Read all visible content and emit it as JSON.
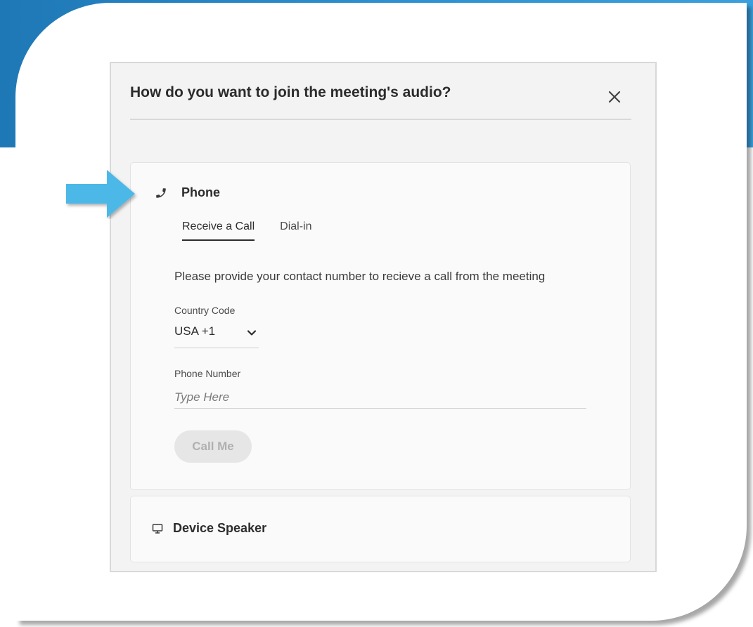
{
  "dialog": {
    "title": "How do you want to join the meeting's audio?",
    "close_icon": "close-icon"
  },
  "phone_section": {
    "icon": "phone-icon",
    "label": "Phone",
    "tabs": [
      {
        "label": "Receive a Call",
        "active": true
      },
      {
        "label": "Dial-in",
        "active": false
      }
    ],
    "instruction": "Please provide your contact number to recieve a call from the meeting",
    "country_code": {
      "label": "Country Code",
      "value": "USA +1",
      "icon": "chevron-down-icon"
    },
    "phone_number": {
      "label": "Phone Number",
      "placeholder": "Type Here",
      "value": ""
    },
    "call_button": {
      "label": "Call Me",
      "enabled": false
    }
  },
  "speaker_section": {
    "icon": "monitor-icon",
    "label": "Device Speaker"
  },
  "annotation": {
    "icon": "arrow-right-icon"
  },
  "colors": {
    "banner": "#2d8fcf",
    "arrow": "#4cb8e8",
    "dialog_bg": "#f3f3f3",
    "card_bg": "#fafafa",
    "text": "#2c2c2c",
    "button_disabled_bg": "#e6e6e6",
    "button_disabled_text": "#b0b0b0"
  }
}
